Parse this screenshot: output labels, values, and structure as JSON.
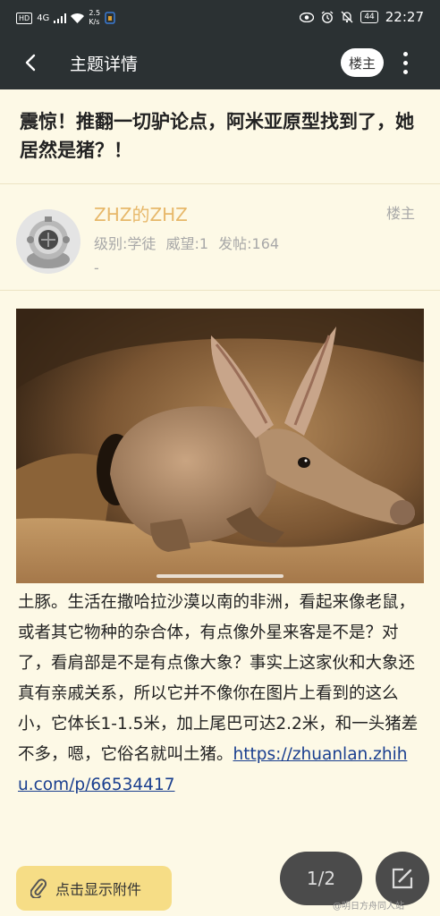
{
  "status_bar": {
    "hd": "HD",
    "network": "4G",
    "speed_value": "2.5",
    "speed_unit": "K/s",
    "battery": "44",
    "time": "22:27"
  },
  "app_bar": {
    "title": "主题详情",
    "op_button": "楼主"
  },
  "topic": {
    "title": "震惊！推翻一切驴论点，阿米亚原型找到了，她居然是猪？！"
  },
  "author": {
    "name": "ZHZ的ZHZ",
    "op_label": "楼主",
    "meta": "级别:学徒  威望:1  发帖:164",
    "extra": "-"
  },
  "post": {
    "body_text": "土豚。生活在撒哈拉沙漠以南的非洲，看起来像老鼠，或者其它物种的杂合体，有点像外星来客是不是？对了，看肩部是不是有点像大象？事实上这家伙和大象还真有亲戚关系，所以它并不像你在图片上看到的这么小，它体长1-1.5米，加上尾巴可达2.2米，和一头猪差不多，嗯，它俗名就叫土猪。",
    "link": "https://zhuanlan.zhihu.com/p/66534417"
  },
  "footer": {
    "attach_label": "点击显示附件",
    "page_indicator": "1/2",
    "watermark": "@明日方舟同人站"
  },
  "icons": {
    "back": "chevron-left-icon",
    "more": "more-vertical-icon",
    "attach": "paperclip-icon",
    "reply": "edit-icon"
  },
  "colors": {
    "header_bg": "#2b3133",
    "page_bg": "#fdf9e6",
    "author_name": "#e7b86a",
    "attach_bg": "#f6dd86",
    "link": "#1a3f8f"
  }
}
